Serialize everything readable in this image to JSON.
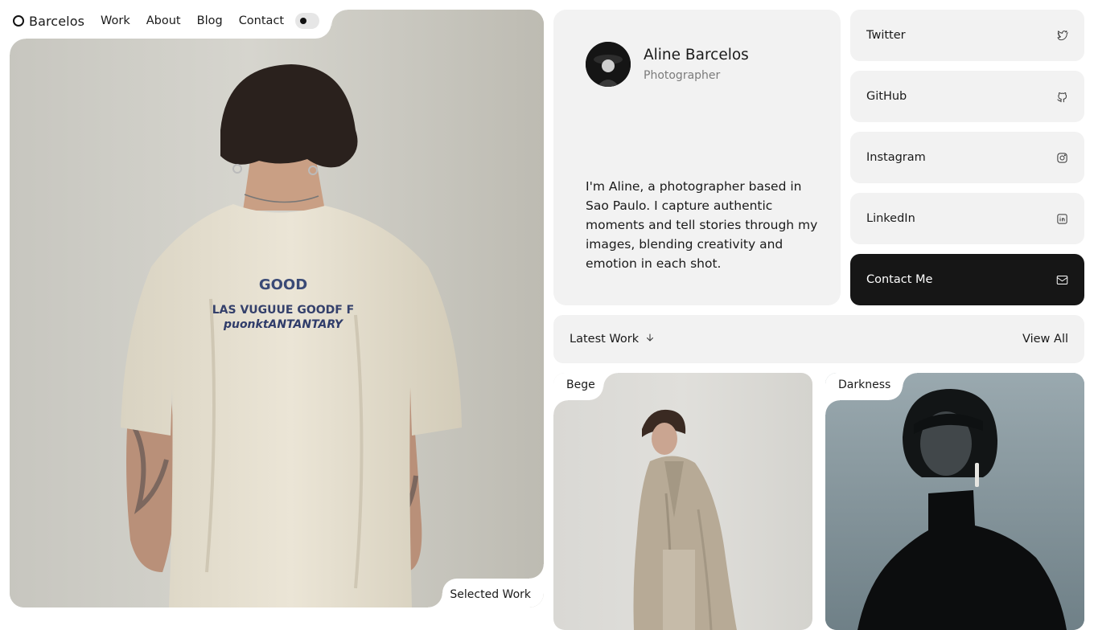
{
  "nav": {
    "brand": "Barcelos",
    "links": [
      "Work",
      "About",
      "Blog",
      "Contact"
    ],
    "theme_toggle": "theme-toggle"
  },
  "hero": {
    "caption": "Selected Work",
    "shirt_print": [
      "GOOD",
      "LAS VUGUUE GOODF F",
      "puonktANTANTARY"
    ]
  },
  "profile": {
    "name": "Aline Barcelos",
    "role": "Photographer",
    "bio": "I'm Aline, a photographer based in Sao Paulo. I capture authentic moments and tell stories through my images, blending creativity and emotion in each shot."
  },
  "social": [
    {
      "label": "Twitter",
      "icon": "twitter-icon"
    },
    {
      "label": "GitHub",
      "icon": "github-icon"
    },
    {
      "label": "Instagram",
      "icon": "instagram-icon"
    },
    {
      "label": "LinkedIn",
      "icon": "linkedin-icon"
    },
    {
      "label": "Contact Me",
      "icon": "mail-icon"
    }
  ],
  "latest": {
    "title": "Latest Work",
    "view_all": "View All",
    "items": [
      {
        "label": "Bege"
      },
      {
        "label": "Darkness"
      }
    ]
  },
  "colors": {
    "card_bg": "#f2f2f2",
    "dark_card": "#161616",
    "text": "#1a1a1a",
    "muted": "#7b7b7b"
  }
}
